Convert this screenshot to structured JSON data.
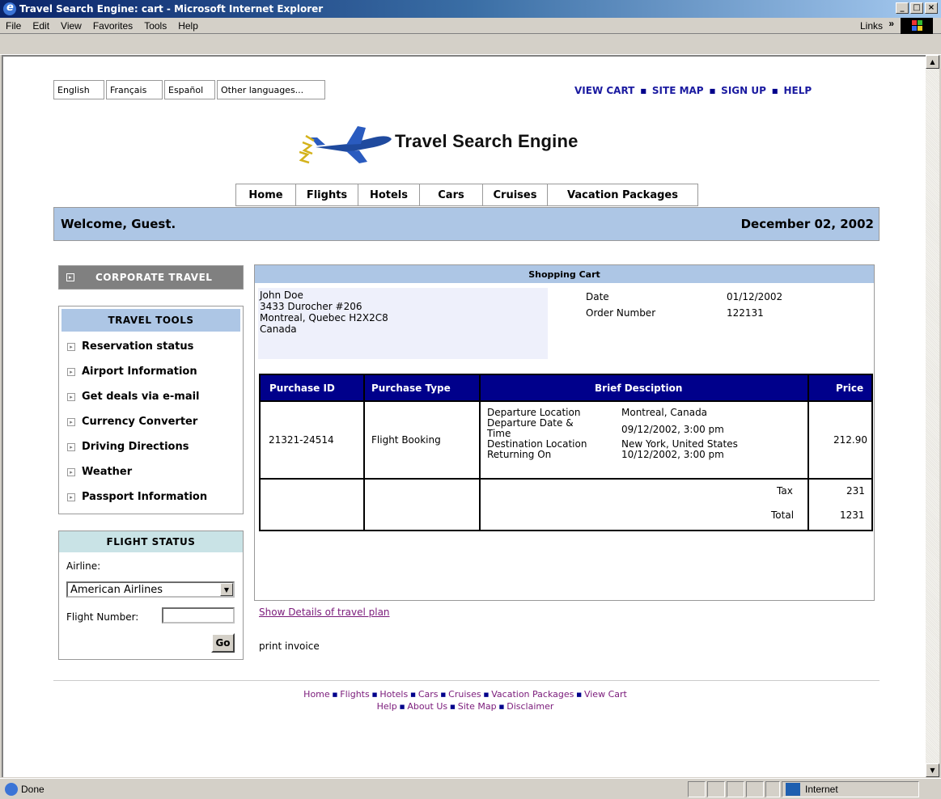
{
  "window": {
    "title": "Travel Search Engine: cart - Microsoft Internet Explorer",
    "min_label": "_",
    "max_label": "□",
    "close_label": "×"
  },
  "menu": {
    "items": [
      "File",
      "Edit",
      "View",
      "Favorites",
      "Tools",
      "Help"
    ],
    "links_label": "Links",
    "links_chevron": "»"
  },
  "status": {
    "text": "Done",
    "zone": "Internet"
  },
  "languages": [
    "English",
    "Français",
    "Español",
    "Other languages..."
  ],
  "top_links": [
    "VIEW CART",
    "SITE MAP",
    "SIGN UP",
    "HELP"
  ],
  "site_title": "Travel Search Engine",
  "nav_tabs": [
    "Home",
    "Flights",
    "Hotels",
    "Cars",
    "Cruises",
    "Vacation Packages"
  ],
  "welcome": "Welcome, Guest.",
  "date": "December 02, 2002",
  "corporate": "CORPORATE TRAVEL",
  "travel_tools": {
    "heading": "TRAVEL TOOLS",
    "items": [
      "Reservation status",
      "Airport Information",
      "Get deals via e-mail",
      "Currency Converter",
      "Driving Directions",
      "Weather",
      "Passport Information"
    ]
  },
  "flight_status": {
    "heading": "FLIGHT STATUS",
    "airline_label": "Airline:",
    "airline_value": "American Airlines",
    "flight_number_label": "Flight Number:",
    "flight_number_value": "",
    "go_label": "Go"
  },
  "cart": {
    "heading": "Shopping Cart",
    "address": [
      "John Doe",
      "3433 Durocher #206",
      "Montreal, Quebec H2X2C8",
      "Canada"
    ],
    "date_label": "Date",
    "date_value": "01/12/2002",
    "order_label": "Order Number",
    "order_value": "122131",
    "columns": [
      "Purchase ID",
      "Purchase Type",
      "Brief Desciption",
      "Price"
    ],
    "row": {
      "id": "21321-24514",
      "type": "Flight Booking",
      "desc_labels": [
        "Departure Location",
        "Departure Date &",
        "Time",
        "Destination Location",
        "Returning On"
      ],
      "desc_values": [
        "Montreal, Canada",
        "09/12/2002, 3:00 pm",
        "New York, United States",
        "10/12/2002, 3:00 pm"
      ],
      "price": "212.90"
    },
    "tax_label": "Tax",
    "tax_value": "231",
    "total_label": "Total",
    "total_value": "1231",
    "details_link": "Show Details of travel plan",
    "print_invoice": "print invoice"
  },
  "footer": {
    "row1": [
      "Home",
      "Flights",
      "Hotels",
      "Cars",
      "Cruises",
      "Vacation Packages",
      "View Cart"
    ],
    "row2": [
      "Help",
      "About Us",
      "Site Map",
      "Disclaimer"
    ]
  }
}
